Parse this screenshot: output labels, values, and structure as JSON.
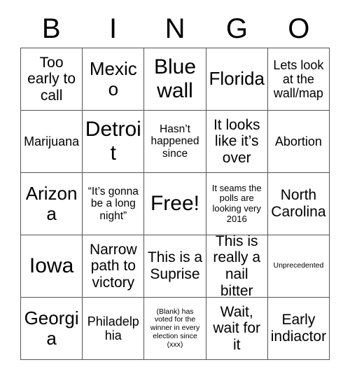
{
  "card": {
    "header_letters": [
      "B",
      "I",
      "N",
      "G",
      "O"
    ],
    "rows": [
      [
        {
          "text": "Too early to call",
          "size": "l"
        },
        {
          "text": "Mexico",
          "size": "xl"
        },
        {
          "text": "Blue wall",
          "size": "xxl"
        },
        {
          "text": "Florida",
          "size": "xl"
        },
        {
          "text": "Lets look at the wall/map",
          "size": "m"
        }
      ],
      [
        {
          "text": "Marijuana",
          "size": "m"
        },
        {
          "text": "Detroit",
          "size": "xxl"
        },
        {
          "text": "Hasn’t happened since",
          "size": "s"
        },
        {
          "text": "It looks like it’s over",
          "size": "l"
        },
        {
          "text": "Abortion",
          "size": "m"
        }
      ],
      [
        {
          "text": "Arizona",
          "size": "xl"
        },
        {
          "text": "“It’s gonna be a long night”",
          "size": "s"
        },
        {
          "text": "Free!",
          "size": "xxl"
        },
        {
          "text": "It seams the polls are looking very 2016",
          "size": "xs"
        },
        {
          "text": "North Carolina",
          "size": "l"
        }
      ],
      [
        {
          "text": "Iowa",
          "size": "xxl"
        },
        {
          "text": "Narrow path to victory",
          "size": "l"
        },
        {
          "text": "This is a Suprise",
          "size": "l"
        },
        {
          "text": "This is really a nail bitter",
          "size": "l"
        },
        {
          "text": "Unprecedented",
          "size": "xxs"
        }
      ],
      [
        {
          "text": "Georgia",
          "size": "xl"
        },
        {
          "text": "Philadelphia",
          "size": "m"
        },
        {
          "text": "(Blank) has voted for the winner in every election since (xxx)",
          "size": "xxs"
        },
        {
          "text": "Wait, wait for it",
          "size": "l"
        },
        {
          "text": "Early indiactor",
          "size": "l"
        }
      ]
    ]
  },
  "colors": {
    "background": "#ffffff",
    "border": "#555555",
    "text": "#000000"
  }
}
